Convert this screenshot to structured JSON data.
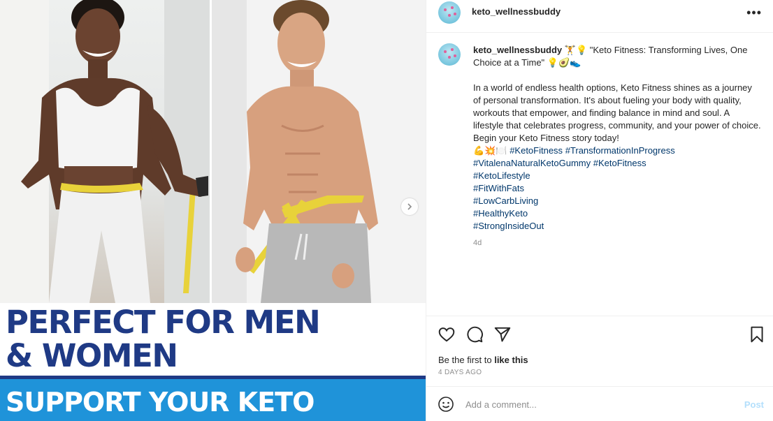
{
  "post": {
    "username": "keto_wellnessbuddy",
    "more_icon": "•••",
    "caption": {
      "title": "🏋️💡 \"Keto Fitness: Transforming Lives, One Choice at a Time\" 💡🥑👟",
      "body": "In a world of endless health options, Keto Fitness shines as a journey of personal transformation. It's about fueling your body with quality, workouts that empower, and finding balance in mind and soul. A lifestyle that celebrates progress, community, and your power of choice. Begin your Keto Fitness story today!",
      "emoji_line": "💪💥🍽️",
      "hashtags_inline": [
        "#KetoFitness",
        "#TransformationInProgress"
      ],
      "hashtags_lines": [
        "#VitalenaNaturalKetoGummy #KetoFitness",
        "#KetoLifestyle",
        "#FitWithFats",
        "#LowCarbLiving",
        "#HealthyKeto",
        "#StrongInsideOut"
      ],
      "age": "4d"
    },
    "likes_prefix": "Be the first to ",
    "likes_action": "like this",
    "date": "4 DAYS AGO",
    "comment_placeholder": "Add a comment...",
    "post_label": "Post"
  },
  "media": {
    "headline_line1": "PERFECT FOR MEN",
    "headline_line2": "& WOMEN",
    "band_text": "SUPPORT YOUR KETO"
  },
  "icons": {
    "like": "heart-icon",
    "comment": "comment-icon",
    "share": "paper-plane-icon",
    "save": "bookmark-icon",
    "emoji": "smiley-icon",
    "next": "chevron-right-icon"
  },
  "colors": {
    "headline": "#1f3a85",
    "band": "#1f93d9",
    "hashtag": "#00376b",
    "post_disabled": "#b3dffc"
  }
}
